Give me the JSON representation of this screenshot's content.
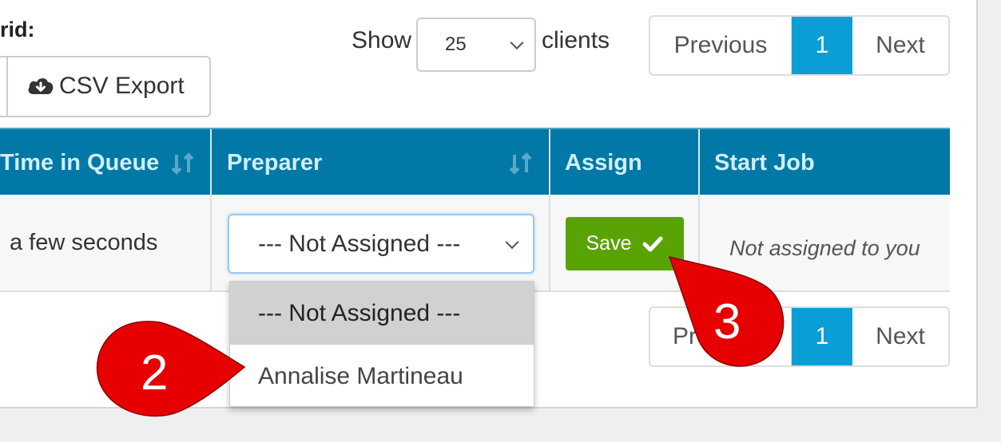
{
  "toolbar": {
    "grid_label": "rid:",
    "csv_export_label": "CSV Export",
    "show_label": "Show",
    "page_size_value": "25",
    "clients_label": "clients"
  },
  "pagination_top": {
    "previous": "Previous",
    "current": "1",
    "next": "Next"
  },
  "pagination_bottom": {
    "previous_partial": "Pr",
    "current": "1",
    "next": "Next"
  },
  "table": {
    "columns": [
      "Time in Queue",
      "Preparer",
      "Assign",
      "Start Job"
    ],
    "rows": [
      {
        "time_in_queue": "a few seconds",
        "preparer": "--- Not Assigned ---",
        "assign_label": "Save",
        "start_job": "Not assigned to you"
      }
    ]
  },
  "preparer_dropdown": {
    "options": [
      "--- Not Assigned ---",
      "Annalise Martineau"
    ],
    "selected_index": 0
  },
  "callouts": [
    {
      "number": "2",
      "color": "#e60000"
    },
    {
      "number": "3",
      "color": "#e60000"
    }
  ],
  "colors": {
    "header_bg": "#0178a5",
    "header_text": "#cfeef9",
    "pager_active": "#0b9ed6",
    "save_button": "#5aa304",
    "callout": "#e60000"
  }
}
